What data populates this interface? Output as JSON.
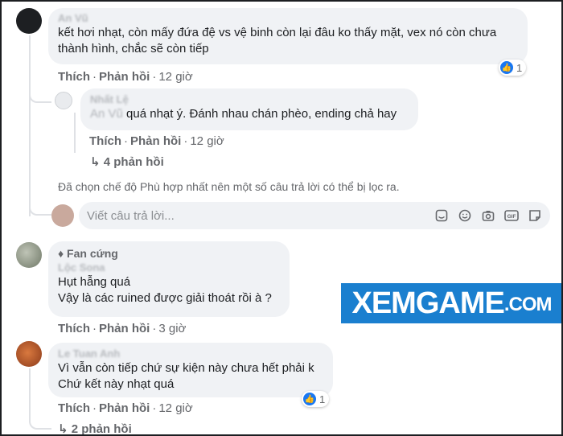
{
  "comments": [
    {
      "author": "An Vũ",
      "lines": [
        "kết hơi nhạt, còn mấy đứa đệ vs vệ binh còn lại đâu ko thấy mặt, vex nó còn chưa",
        "thành hình, chắc sẽ còn tiếp"
      ],
      "actions": {
        "like": "Thích",
        "reply": "Phản hồi",
        "time": "12 giờ"
      },
      "reaction_count": "1",
      "reply": {
        "author": "Nhất Lệ",
        "mention": "An Vũ",
        "text": "quá nhạt ý. Đánh nhau chán phèo, ending chả hay",
        "actions": {
          "like": "Thích",
          "reply": "Phản hồi",
          "time": "12 giờ"
        },
        "replies_label": "4 phản hồi"
      }
    },
    {
      "badge": "Fan cứng",
      "author": "Lộc Sona",
      "lines": [
        "Hụt hẫng quá",
        "Vậy là các ruined được giải thoát rồi à ?"
      ],
      "actions": {
        "like": "Thích",
        "reply": "Phản hồi",
        "time": "3 giờ"
      }
    },
    {
      "author": "Le Tuan Anh",
      "lines": [
        "Vì vẫn còn tiếp chứ sự kiện này chưa hết phải k",
        "Chứ kết này nhạt quá"
      ],
      "actions": {
        "like": "Thích",
        "reply": "Phản hồi",
        "time": "12 giờ"
      },
      "reaction_count": "1",
      "replies_label": "2 phản hồi"
    }
  ],
  "filter_notice": "Đã chọn chế độ Phù hợp nhất nên một số câu trả lời có thể bị lọc ra.",
  "reply_box": {
    "placeholder": "Viết câu trả lời..."
  },
  "watermark": {
    "main": "XEMGAME",
    "suffix": ".COM"
  },
  "colors": {
    "like_blue": "#1877f2",
    "watermark_bg": "#1a7fcf",
    "bubble": "#f0f2f5",
    "meta_gray": "#65676b"
  },
  "icons": [
    "like-icon",
    "reply-arrow-icon",
    "sticker-icon",
    "emoji-icon",
    "camera-icon",
    "gif-icon",
    "sticker-pack-icon",
    "diamond-badge-icon"
  ]
}
